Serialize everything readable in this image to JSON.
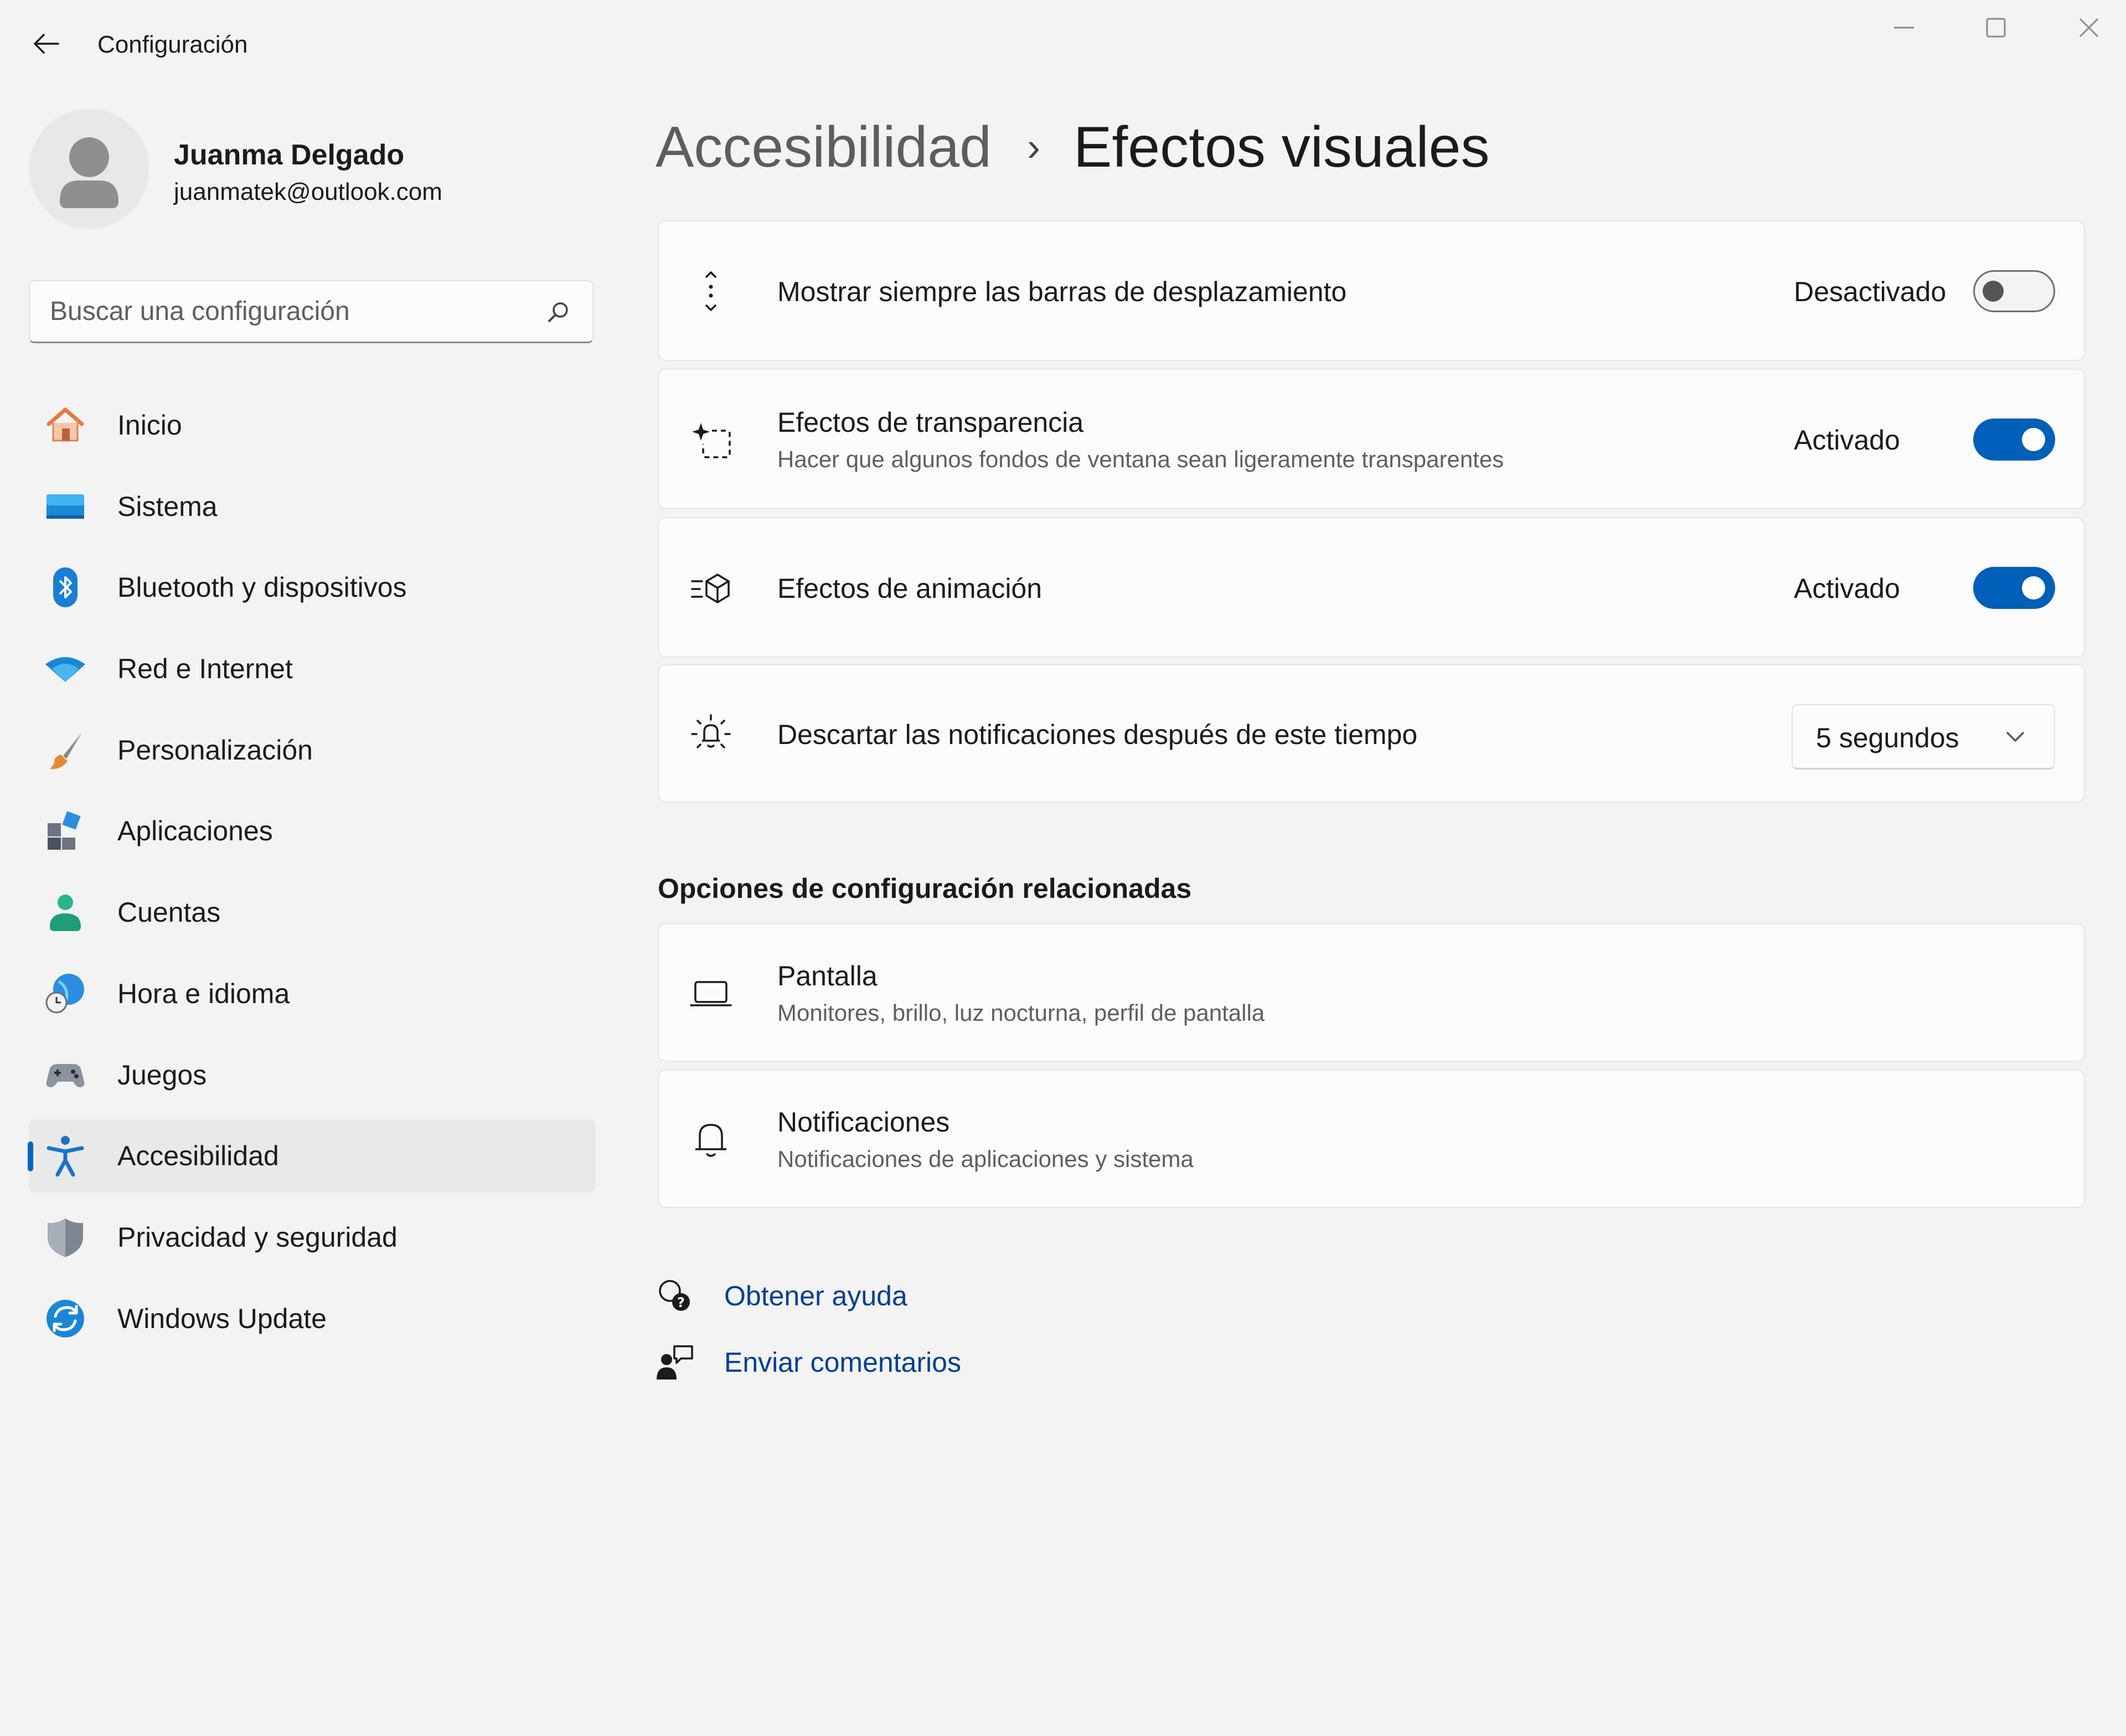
{
  "window": {
    "title": "Configuración"
  },
  "profile": {
    "name": "Juanma Delgado",
    "email": "juanmatek@outlook.com"
  },
  "search": {
    "placeholder": "Buscar una configuración",
    "value": ""
  },
  "sidebar": {
    "items": [
      {
        "label": "Inicio",
        "icon": "home-icon"
      },
      {
        "label": "Sistema",
        "icon": "system-icon"
      },
      {
        "label": "Bluetooth y dispositivos",
        "icon": "bluetooth-icon"
      },
      {
        "label": "Red e Internet",
        "icon": "wifi-icon"
      },
      {
        "label": "Personalización",
        "icon": "brush-icon"
      },
      {
        "label": "Aplicaciones",
        "icon": "apps-icon"
      },
      {
        "label": "Cuentas",
        "icon": "account-icon"
      },
      {
        "label": "Hora e idioma",
        "icon": "time-language-icon"
      },
      {
        "label": "Juegos",
        "icon": "gamepad-icon"
      },
      {
        "label": "Accesibilidad",
        "icon": "accessibility-icon",
        "selected": true
      },
      {
        "label": "Privacidad y seguridad",
        "icon": "shield-icon"
      },
      {
        "label": "Windows Update",
        "icon": "windows-update-icon"
      }
    ]
  },
  "breadcrumb": {
    "parent": "Accesibilidad",
    "separator": "›",
    "current": "Efectos visuales"
  },
  "settings": [
    {
      "title": "Mostrar siempre las barras de desplazamiento",
      "state": "Desactivado",
      "on": false,
      "icon": "scrollbar-icon"
    },
    {
      "title": "Efectos de transparencia",
      "subtitle": "Hacer que algunos fondos de ventana sean ligeramente transparentes",
      "state": "Activado",
      "on": true,
      "icon": "transparency-icon"
    },
    {
      "title": "Efectos de animación",
      "state": "Activado",
      "on": true,
      "icon": "animation-icon"
    },
    {
      "title": "Descartar las notificaciones después de este tiempo",
      "dropdown_value": "5 segundos",
      "icon": "notification-timer-icon"
    }
  ],
  "related": {
    "heading": "Opciones de configuración relacionadas",
    "items": [
      {
        "title": "Pantalla",
        "subtitle": "Monitores, brillo, luz nocturna, perfil de pantalla",
        "icon": "display-icon"
      },
      {
        "title": "Notificaciones",
        "subtitle": "Notificaciones de aplicaciones y sistema",
        "icon": "bell-icon"
      }
    ]
  },
  "help": {
    "get_help": "Obtener ayuda",
    "feedback": "Enviar comentarios"
  },
  "colors": {
    "accent": "#005fb8",
    "link": "#003e92",
    "background": "#f3f3f3",
    "card": "#fbfbfb"
  }
}
